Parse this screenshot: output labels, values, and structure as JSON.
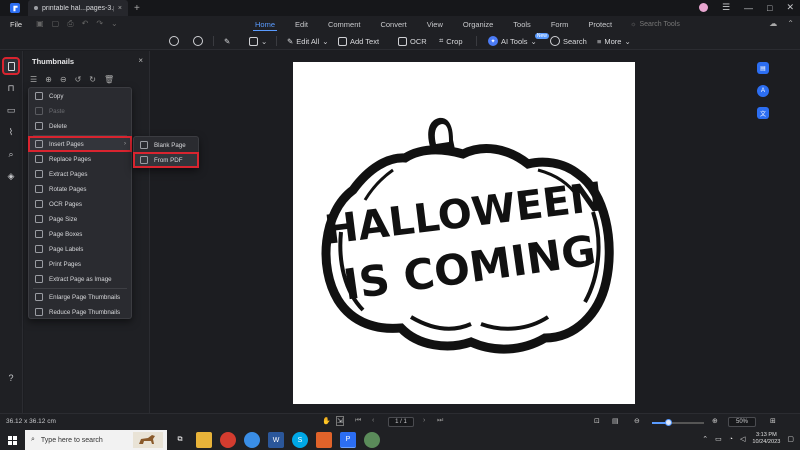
{
  "titlebar": {
    "tab_name": "printable hal...pages-3.pdf",
    "close_glyph": "×",
    "newtab_glyph": "+",
    "minimize_glyph": "—",
    "maximize_glyph": "□",
    "exit_glyph": "✕"
  },
  "menubar": {
    "file_label": "File",
    "tabs": [
      "Home",
      "Edit",
      "Comment",
      "Convert",
      "View",
      "Organize",
      "Tools",
      "Form",
      "Protect"
    ],
    "active_tab": "Home",
    "search_tools_label": "Search Tools"
  },
  "toolbar": {
    "edit_all_label": "Edit All",
    "add_text_label": "Add Text",
    "ocr_label": "OCR",
    "crop_label": "Crop",
    "ai_tools_label": "AI Tools",
    "ai_badge": "New",
    "search_label": "Search",
    "more_label": "More"
  },
  "panel": {
    "title": "Thumbnails",
    "close_glyph": "×"
  },
  "context_menu": {
    "items": [
      {
        "label": "Copy",
        "disabled": false
      },
      {
        "label": "Paste",
        "disabled": true
      },
      {
        "label": "Delete",
        "disabled": false
      },
      {
        "label": "Insert Pages",
        "disabled": false,
        "highlighted": true,
        "submenu": true
      },
      {
        "label": "Replace Pages",
        "disabled": false
      },
      {
        "label": "Extract Pages",
        "disabled": false
      },
      {
        "label": "Rotate Pages",
        "disabled": false
      },
      {
        "label": "OCR Pages",
        "disabled": false
      },
      {
        "label": "Page Size",
        "disabled": false
      },
      {
        "label": "Page Boxes",
        "disabled": false
      },
      {
        "label": "Page Labels",
        "disabled": false
      },
      {
        "label": "Print Pages",
        "disabled": false
      },
      {
        "label": "Extract Page as Image",
        "disabled": false
      },
      {
        "label": "Enlarge Page Thumbnails",
        "disabled": false
      },
      {
        "label": "Reduce Page Thumbnails",
        "disabled": false
      }
    ],
    "submenu": [
      {
        "label": "Blank Page"
      },
      {
        "label": "From PDF",
        "highlighted": true
      }
    ]
  },
  "document": {
    "line1": "HALLOWEEN",
    "line2": "IS COMING"
  },
  "status": {
    "dimensions": "36.12 x 36.12 cm",
    "page_indicator": "1 / 1",
    "zoom": "50%",
    "zoom_fraction": 0.3
  },
  "taskbar": {
    "search_placeholder": "Type here to search",
    "time": "3:13 PM",
    "date": "10/24/2023"
  },
  "colors": {
    "accent": "#5a9bff",
    "highlight_box": "#d9242f",
    "app_blue": "#2c6ef2"
  }
}
